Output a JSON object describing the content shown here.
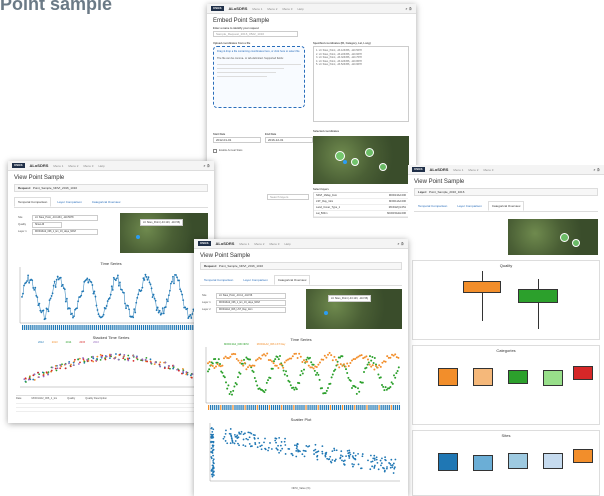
{
  "page_title": "Point sample",
  "app": {
    "brand": "ALoSDRS",
    "logo": "USGS",
    "nav": [
      "Menu 1",
      "Menu 2",
      "Menu 3",
      "Help"
    ]
  },
  "embed_window": {
    "title": "Embed Point Sample",
    "name_label": "Enter a name to identify your request",
    "name_placeholder": "Sample_Request_2016_0522_1016",
    "upload_label": "Upload coordinates from a file",
    "upload_text": "Drag & drop a file containing coordinates here, or click here to select file",
    "upload_note": "The file can be comma- or tab-delimited. Supported fields:",
    "coords_label": "Specified coordinates (ID, Category, Lat, Long)",
    "coords_lines": [
      "1. LC Sites_Point,  -43.123456, -110.5678",
      "2. LC Sites_Point,  -43.223456, -110.6678",
      "3. LC Sites_Point,  -43.323456, -110.7678",
      "4. LC Sites_Point,  -43.423456, -110.8678",
      "5. LC Sites_Point,  -43.523456, -110.9678"
    ],
    "start_label": "Start Date",
    "end_label": "End Date",
    "start_value": "2012-01-01",
    "end_value": "2016-12-31",
    "checkbox_label": "Enable Annual Stats",
    "map_label": "Selected coordinates",
    "layers_label": "Select layers",
    "layers": [
      {
        "name": "NDVI_16day_1km",
        "meta": "MOD13A2.006"
      },
      {
        "name": "LST_Day_1km",
        "meta": "MOD11A2.006"
      },
      {
        "name": "Land_Cover_Type_1",
        "meta": "MCD12Q1.051"
      },
      {
        "name": "Lai_500m",
        "meta": "MCD15A2H.006"
      }
    ],
    "layer_search_placeholder": "Search layers"
  },
  "view_left": {
    "title": "View Point Sample",
    "request_label": "Request:",
    "request_value": "Point_Sample_NDVI_2016_1016",
    "tabs": [
      "Temporal Comparison",
      "Layer Comparison",
      "Categorical Overview"
    ],
    "fields": [
      {
        "label": "Site",
        "value": "LC Sites_Point_-43.1234_-110.5678"
      },
      {
        "label": "Quality",
        "value": "Show All"
      },
      {
        "label": "Layer 1",
        "value": "MOD13A2_006_1_km_16_days_NDVI"
      }
    ],
    "map_callout": "LC Sites_Point (-43.123, -110.56)",
    "chart_title": "Time Series",
    "chart_ylabel": "Value",
    "chart2_title": "Stacked Time Series",
    "chart2_legend": [
      "2012",
      "2013",
      "2014",
      "2015",
      "2016"
    ],
    "table_headers": [
      "Date",
      "MOD13A2_006_1_km",
      "Quality",
      "Quality Description"
    ]
  },
  "view_mid": {
    "title": "View Point Sample",
    "request_label": "Request:",
    "request_value": "Point_Sample_NDVI_2016_1016",
    "tabs": [
      "Temporal Comparison",
      "Layer Comparison",
      "Categorical Overview"
    ],
    "fields": [
      {
        "label": "Site",
        "value": "LC Sites_Point_-43.12_-110.56"
      },
      {
        "label": "Layer 1",
        "value": "MOD13A2_006_1_km_16_days_NDVI"
      },
      {
        "label": "Layer 2",
        "value": "MOD11A2_006_LST_Day_1km"
      }
    ],
    "map_callout": "LC Sites_Point (-43.123, -110.56)",
    "chart_title": "Time Series",
    "legend": [
      "MOD13A2_006 NDVI",
      "MOD11A2_006 LST Day"
    ],
    "chart2_title": "Scatter Plot",
    "chart2_xlabel": "NDVI_Value (%)"
  },
  "view_right": {
    "title": "View Point Sample",
    "request_label": "Layer:",
    "request_value": "Point_Sample_2016_1016",
    "tabs": [
      "Temporal Comparison",
      "Layer Comparison",
      "Categorical Overview"
    ],
    "charts": [
      {
        "title": "Quality",
        "colors": [
          "#f28e2b",
          "#2ca02c"
        ]
      },
      {
        "title": "Categories",
        "colors": [
          "#f28e2b",
          "#f5b87a",
          "#2ca02c",
          "#98df8a",
          "#d62728"
        ]
      },
      {
        "title": "Sites",
        "colors": [
          "#1f77b4",
          "#6baed6",
          "#9ecae1",
          "#c6dbef",
          "#f28e2b"
        ]
      }
    ]
  },
  "colors": {
    "accent": "#2a6ebb",
    "series_blue": "#1f77b4",
    "series_orange": "#f28e2b",
    "series_green": "#2ca02c"
  }
}
